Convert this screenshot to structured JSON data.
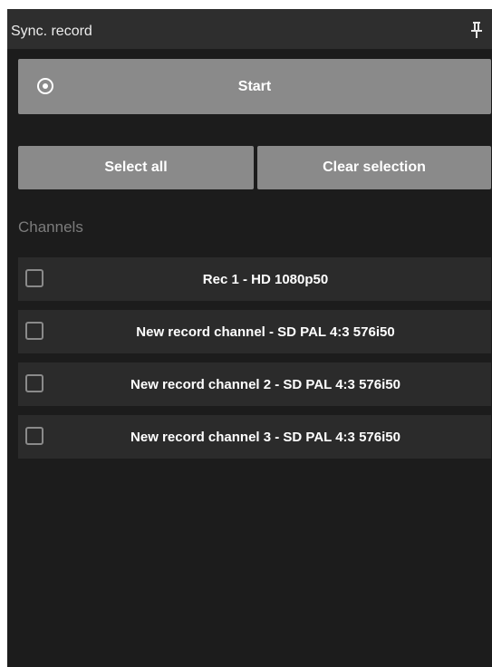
{
  "panel": {
    "title": "Sync. record",
    "pin_icon": "pin-icon"
  },
  "actions": {
    "start_label": "Start",
    "start_icon": "record-target-icon",
    "select_all_label": "Select all",
    "clear_selection_label": "Clear selection"
  },
  "channels": {
    "heading": "Channels",
    "items": [
      {
        "label": "Rec 1 - HD 1080p50",
        "checked": false
      },
      {
        "label": "New record channel - SD PAL 4:3 576i50",
        "checked": false
      },
      {
        "label": "New record channel 2 - SD PAL 4:3 576i50",
        "checked": false
      },
      {
        "label": "New record channel 3 - SD PAL 4:3 576i50",
        "checked": false
      }
    ]
  },
  "colors": {
    "panel_bg": "#1c1c1c",
    "titlebar_bg": "#2e2e2e",
    "button_bg": "#8a8a8a",
    "row_bg": "#2b2b2b",
    "muted_text": "#7c7c7c"
  }
}
